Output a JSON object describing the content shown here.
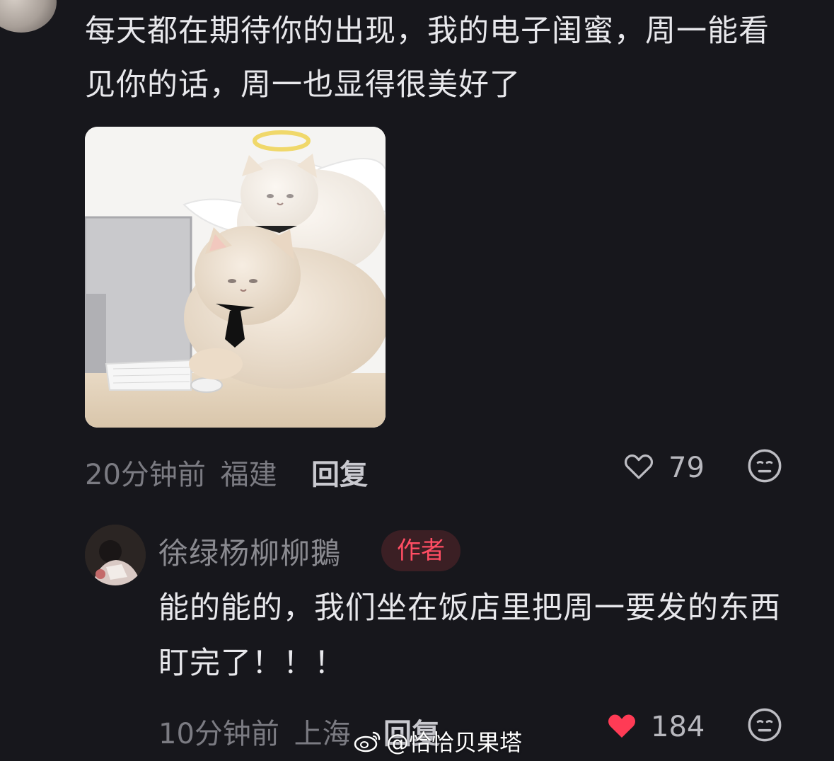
{
  "comment1": {
    "text": "每天都在期待你的出现，我的电子闺蜜，周一能看见你的话，周一也显得很美好了",
    "time": "20分钟前",
    "location": "福建",
    "reply_label": "回复",
    "like_count": "79",
    "liked": false
  },
  "comment2": {
    "username": "徐绿杨柳柳鵝",
    "badge": "作者",
    "text": "能的能的，我们坐在饭店里把周一要发的东西盯完了！！！",
    "time": "10分钟前",
    "location": "上海",
    "reply_label": "回复",
    "like_count": "184",
    "liked": true
  },
  "watermark": {
    "text": "@恰恰贝果塔"
  },
  "colors": {
    "background": "#17171c",
    "like_active": "#ff3b55",
    "badge_text": "#ff4d63",
    "badge_bg": "#3b1f24"
  }
}
